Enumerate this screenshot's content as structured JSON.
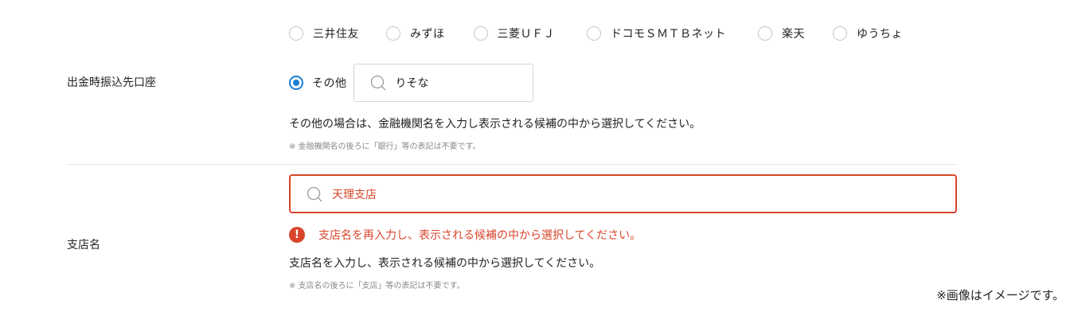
{
  "payout_account": {
    "label": "出金時振込先口座",
    "bank_options": [
      {
        "label": "三井住友",
        "checked": false
      },
      {
        "label": "みずほ",
        "checked": false
      },
      {
        "label": "三菱ＵＦＪ",
        "checked": false
      },
      {
        "label": "ドコモＳＭＴＢネット",
        "checked": false
      },
      {
        "label": "楽天",
        "checked": false
      },
      {
        "label": "ゆうちょ",
        "checked": false
      }
    ],
    "other_option": {
      "label": "その他",
      "checked": true
    },
    "other_search_value": "りそな",
    "help": "その他の場合は、金融機関名を入力し表示される候補の中から選択してください。",
    "note": "※ 金融機関名の後ろに「銀行」等の表記は不要です。"
  },
  "branch": {
    "label": "支店名",
    "search_value": "天理支店",
    "error": "支店名を再入力し、表示される候補の中から選択してください。",
    "help": "支店名を入力し、表示される候補の中から選択してください。",
    "note": "※ 支店名の後ろに「支店」等の表記は不要です。"
  },
  "disclaimer": "※画像はイメージです。",
  "icons": {
    "search": "search-icon",
    "error": "exclamation-circle-icon",
    "error_glyph": "!"
  },
  "colors": {
    "accent": "#1a7fd4",
    "error": "#d9452b",
    "border": "#d4d4d4",
    "note": "#8a8a8a"
  }
}
